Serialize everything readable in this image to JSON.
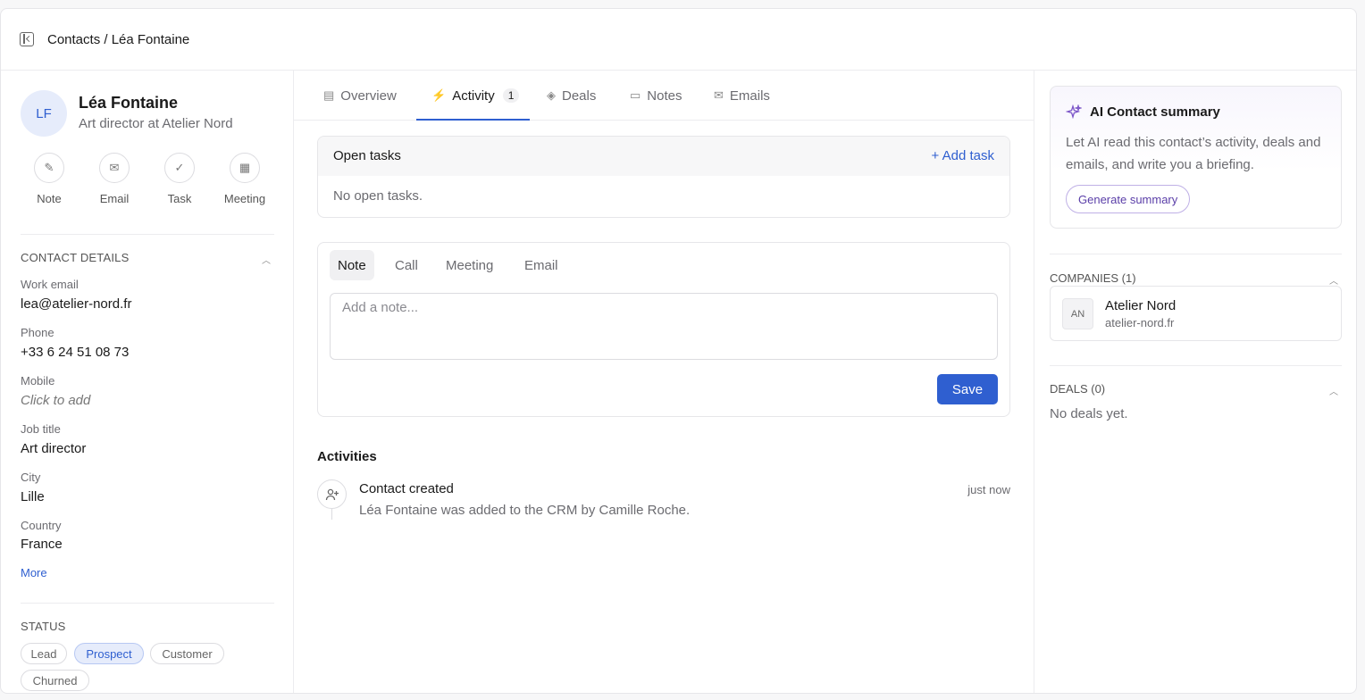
{
  "breadcrumb": "Contacts / Léa Fontaine",
  "contact": {
    "initials": "LF",
    "name": "Léa Fontaine",
    "subtitle": "Art director at Atelier Nord"
  },
  "quick_actions": [
    {
      "label": "Note",
      "icon": "pencil-icon"
    },
    {
      "label": "Email",
      "icon": "mail-icon"
    },
    {
      "label": "Task",
      "icon": "check-circle-icon"
    },
    {
      "label": "Meeting",
      "icon": "calendar-icon"
    }
  ],
  "details": {
    "section_title": "CONTACT DETAILS",
    "fields": [
      {
        "label": "Work email",
        "value": "lea@atelier-nord.fr"
      },
      {
        "label": "Phone",
        "value": "+33 6 24 51 08 73"
      },
      {
        "label": "Mobile",
        "value": "Click to add"
      },
      {
        "label": "Job title",
        "value": "Art director"
      },
      {
        "label": "City",
        "value": "Lille"
      },
      {
        "label": "Country",
        "value": "France"
      }
    ],
    "more_label": "More"
  },
  "status": {
    "section_title": "STATUS",
    "options": [
      "Lead",
      "Prospect",
      "Customer",
      "Churned"
    ],
    "selected": "Prospect"
  },
  "tabs": [
    {
      "label": "Overview",
      "icon": "document-icon"
    },
    {
      "label": "Activity",
      "icon": "bolt-icon",
      "badge": "1"
    },
    {
      "label": "Deals",
      "icon": "tag-icon"
    },
    {
      "label": "Notes",
      "icon": "note-icon"
    },
    {
      "label": "Emails",
      "icon": "mail-icon"
    }
  ],
  "active_tab": "Activity",
  "tasks": {
    "title": "Open tasks",
    "add_label": "+ Add task",
    "empty": "No open tasks."
  },
  "composer": {
    "tabs": [
      "Note",
      "Call",
      "Meeting",
      "Email"
    ],
    "active": "Note",
    "placeholder": "Add a note...",
    "save_label": "Save"
  },
  "activities": {
    "title": "Activities",
    "items": [
      {
        "icon": "user-plus-icon",
        "title": "Contact created",
        "time": "just now",
        "description": "Léa Fontaine was added to the CRM by Camille Roche."
      }
    ]
  },
  "ai_summary": {
    "title": "AI Contact summary",
    "description": "Let AI read this contact’s activity, deals and emails, and write you a briefing.",
    "button_label": "Generate summary"
  },
  "companies": {
    "section_title": "COMPANIES (1)",
    "items": [
      {
        "initials": "AN",
        "name": "Atelier Nord",
        "domain": "atelier-nord.fr"
      }
    ]
  },
  "deals": {
    "section_title": "DEALS (0)",
    "empty": "No deals yet."
  },
  "colors": {
    "accent": "#2f5fd0",
    "ai_accent": "#7b55c8"
  }
}
